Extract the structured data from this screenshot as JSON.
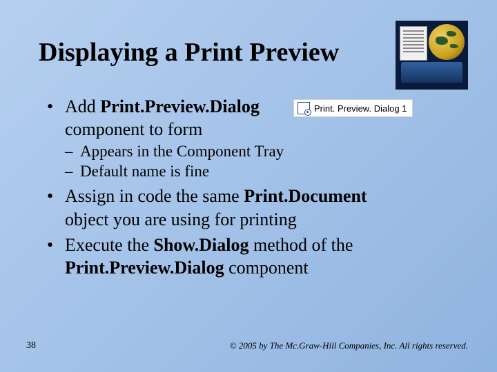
{
  "title": "Displaying a Print Preview",
  "component_tag": {
    "label": "Print. Preview. Dialog 1"
  },
  "bullets": {
    "b1": {
      "pre": "Add ",
      "bold": "Print.Preview.Dialog",
      "line2": "component to form",
      "subs": {
        "s1": "Appears in the Component Tray",
        "s2": "Default name is fine"
      }
    },
    "b2": {
      "line1_pre": "Assign in code the same ",
      "line1_bold": "Print.Document",
      "line2": "object you are using for printing"
    },
    "b3": {
      "line1_pre": "Execute the ",
      "line1_bold": "Show.Dialog",
      "line1_post": " method of the",
      "line2_bold": "Print.Preview.Dialog",
      "line2_post": " component"
    }
  },
  "page_number": "38",
  "copyright": "© 2005 by The Mc.Graw-Hill Companies, Inc. All rights reserved."
}
